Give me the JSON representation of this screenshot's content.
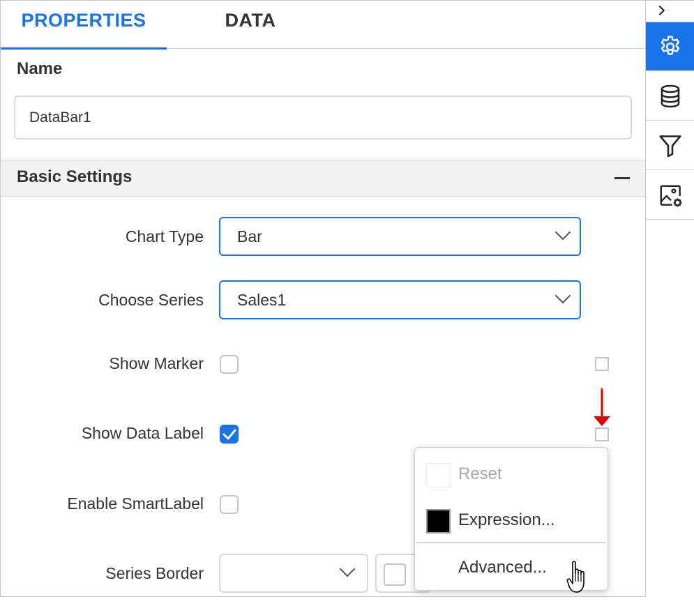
{
  "tabs": [
    {
      "label": "PROPERTIES",
      "active": true
    },
    {
      "label": "DATA",
      "active": false
    }
  ],
  "name_section": {
    "label": "Name",
    "value": "DataBar1"
  },
  "basic_settings": {
    "title": "Basic Settings",
    "collapse_icon": "minus-icon",
    "rows": {
      "chart_type": {
        "label": "Chart Type",
        "value": "Bar"
      },
      "choose_series": {
        "label": "Choose Series",
        "value": "Sales1"
      },
      "show_marker": {
        "label": "Show Marker",
        "checked": false
      },
      "show_data_label": {
        "label": "Show Data Label",
        "checked": true
      },
      "enable_smartlabel": {
        "label": "Enable SmartLabel",
        "checked": false
      },
      "series_border": {
        "label": "Series Border",
        "value": ""
      }
    }
  },
  "context_menu": {
    "items": [
      {
        "label": "Reset",
        "enabled": false
      },
      {
        "label": "Expression...",
        "enabled": true
      },
      {
        "label": "Advanced...",
        "enabled": true
      }
    ]
  },
  "sidebar": {
    "toggle_icon": "chevron-right-icon",
    "buttons": [
      {
        "icon": "gear-icon",
        "active": true
      },
      {
        "icon": "database-icon",
        "active": false
      },
      {
        "icon": "filter-icon",
        "active": false
      },
      {
        "icon": "image-settings-icon",
        "active": false
      }
    ]
  },
  "colors": {
    "accent": "#1a73e8",
    "arrow": "#e00000",
    "text": "#333333"
  }
}
